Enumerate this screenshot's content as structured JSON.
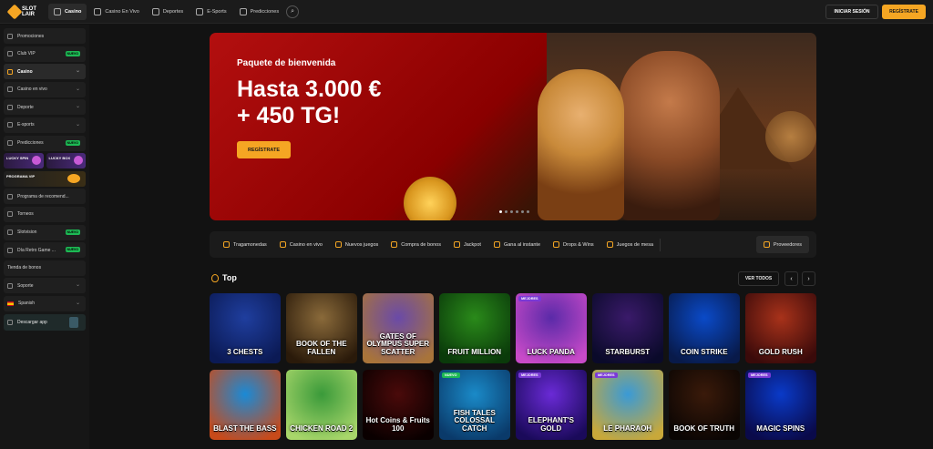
{
  "logo": {
    "line1": "SLOT",
    "line2": "LAIR"
  },
  "nav": [
    {
      "label": "Casino",
      "active": true,
      "icon": "casino-icon"
    },
    {
      "label": "Casino En Vivo",
      "icon": "live-dealer-icon"
    },
    {
      "label": "Deportes",
      "icon": "sports-icon"
    },
    {
      "label": "E-Sports",
      "icon": "gamepad-icon"
    },
    {
      "label": "Predicciones",
      "icon": "chart-icon"
    }
  ],
  "header": {
    "login_label": "INICIAR SESIÓN",
    "register_label": "REGÍSTRATE"
  },
  "sidebar": {
    "items": [
      {
        "label": "Promociones"
      },
      {
        "label": "Club VIP",
        "badge": "NUEVO"
      },
      {
        "label": "Casino",
        "chevron": "⌄",
        "active": true
      },
      {
        "label": "Casino en vivo",
        "chevron": "⌄"
      },
      {
        "label": "Deporte",
        "chevron": "⌄"
      },
      {
        "label": "E-sports",
        "chevron": "⌄"
      },
      {
        "label": "Predicciones",
        "badge": "NUEVO"
      }
    ],
    "promo_tiles": [
      "LUCKY SPIN",
      "LUCKY BOX"
    ],
    "vip_tile": "PROGRAMA VIP",
    "items2": [
      {
        "label": "Programa de recomend..."
      },
      {
        "label": "Torneos"
      },
      {
        "label": "Slotvision",
        "badge": "NUEVO"
      },
      {
        "label": "Día Retro Game ...",
        "badge": "NUEVO"
      },
      {
        "label": "Tienda de bonos"
      },
      {
        "label": "Soporte",
        "chevron": "⌄"
      },
      {
        "label": "Spanish",
        "chevron": "⌄"
      }
    ],
    "app_label": "Descargar app"
  },
  "hero": {
    "title": "Paquete de bienvenida",
    "headline_1": "Hasta 3.000 €",
    "headline_2": "+ 450 TG!",
    "cta": "REGÍSTRATE",
    "slides": 6,
    "active_slide": 1
  },
  "categories": [
    {
      "label": "Tragamonedas"
    },
    {
      "label": "Casino en vivo"
    },
    {
      "label": "Nuevos juegos"
    },
    {
      "label": "Compra de bonos"
    },
    {
      "label": "Jackpot"
    },
    {
      "label": "Gana al instante"
    },
    {
      "label": "Drops & Wins"
    },
    {
      "label": "Juegos de mesa"
    }
  ],
  "providers_label": "Proveedores",
  "top": {
    "title": "Top",
    "view_all": "VER TODOS",
    "prev": "‹",
    "next": "›"
  },
  "games": [
    {
      "title": "3 CHESTS",
      "bg": "#1f3e9e",
      "bg2": "#0b1a55"
    },
    {
      "title": "BOOK OF THE FALLEN",
      "bg": "#8a6a3a",
      "bg2": "#2a1a0a"
    },
    {
      "title": "GATES OF OLYMPUS SUPER SCATTER",
      "bg": "#6a4aa8",
      "bg2": "#a8743a"
    },
    {
      "title": "FRUIT MILLION",
      "bg": "#2a8a1a",
      "bg2": "#0a3a0a"
    },
    {
      "title": "LUCK PANDA",
      "bg": "#5a2aa8",
      "bg2": "#c84ac8",
      "tag": "MEJORES",
      "tag_color": "#7a3ad6"
    },
    {
      "title": "STARBURST",
      "bg": "#3a1a6a",
      "bg2": "#0a0a2a"
    },
    {
      "title": "COIN STRIKE",
      "bg": "#0a4ac8",
      "bg2": "#081a4a"
    },
    {
      "title": "GOLD RUSH",
      "bg": "#a8321a",
      "bg2": "#3a0a0a"
    },
    {
      "title": "BLAST THE BASS",
      "bg": "#1a8ad6",
      "bg2": "#c84a1a"
    },
    {
      "title": "CHICKEN ROAD 2",
      "bg": "#3a9a3a",
      "bg2": "#a8d66a"
    },
    {
      "title": "Hot Coins & Fruits 100",
      "bg": "#4a0a0a",
      "bg2": "#0a0000"
    },
    {
      "title": "FISH TALES COLOSSAL CATCH",
      "bg": "#1a8ac8",
      "bg2": "#0a3a6a",
      "tag": "NUEVO",
      "tag_color": "#1db954"
    },
    {
      "title": "ELEPHANT'S GOLD",
      "bg": "#6a2ad6",
      "bg2": "#1a0a5a",
      "tag": "MEJORES",
      "tag_color": "#7a3ad6"
    },
    {
      "title": "LE PHARAOH",
      "bg": "#3a9ad6",
      "bg2": "#c8a83a",
      "tag": "MEJORES",
      "tag_color": "#7a3ad6"
    },
    {
      "title": "BOOK OF TRUTH",
      "bg": "#3a1a0a",
      "bg2": "#0a0503"
    },
    {
      "title": "MAGIC SPINS",
      "bg": "#0a3ac8",
      "bg2": "#0a0a4a",
      "tag": "MEJORES",
      "tag_color": "#7a3ad6"
    }
  ]
}
